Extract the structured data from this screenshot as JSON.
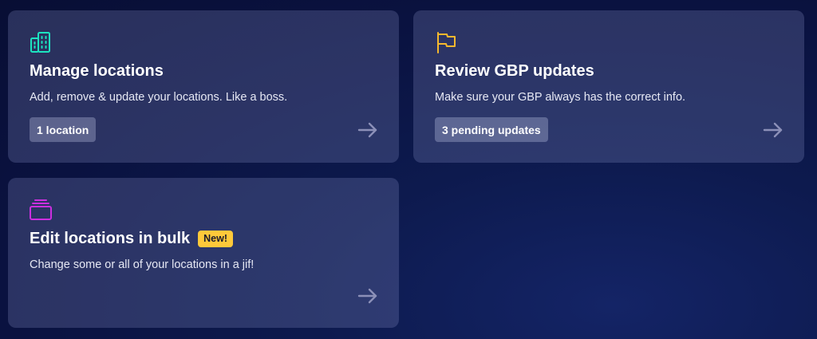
{
  "colors": {
    "background": "#0a1240",
    "card": "#3a3f78",
    "manage_icon": "#1de3c0",
    "review_icon": "#f5b82e",
    "bulk_icon": "#cc2fe0",
    "new_badge": "#ffc93a"
  },
  "cards": {
    "manage": {
      "icon": "building-icon",
      "title": "Manage locations",
      "description": "Add, remove & update your locations. Like a boss.",
      "badge": "1 location",
      "arrow": "arrow-right-icon"
    },
    "review": {
      "icon": "flag-icon",
      "title": "Review GBP updates",
      "description": "Make sure your GBP always has the correct info.",
      "badge": "3 pending updates",
      "arrow": "arrow-right-icon"
    },
    "bulk": {
      "icon": "stack-icon",
      "title": "Edit locations in bulk",
      "new_label": "New!",
      "description": "Change some or all of your locations in a jif!",
      "arrow": "arrow-right-icon"
    }
  }
}
